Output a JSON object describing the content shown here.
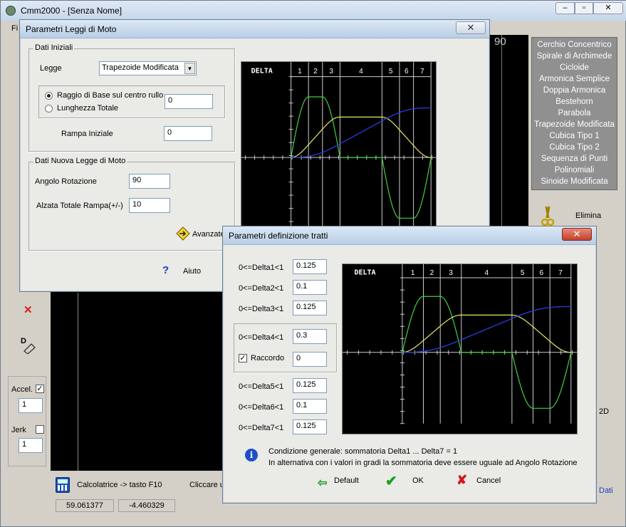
{
  "main": {
    "title": "Cmm2000 - [Senza Nome]",
    "menu_fragment": "Fi",
    "angle_label": "90",
    "elimina": "Elimina",
    "dati": "Dati",
    "side_fragment_2d": "2D",
    "accel_label": "Accel.",
    "accel_value": "1",
    "jerk_label": "Jerk",
    "jerk_value": "1",
    "calc_label": "Calcolatrice -> tasto F10",
    "click_fragment": "Cliccare u",
    "coord_x": "59.061377",
    "coord_y": "-4.460329",
    "laws_list": [
      "Cerchio Concentrico",
      "Spirale di Archimede",
      "Cicloide",
      "Armonica Semplice",
      "Doppia Armonica",
      "Bestehorn",
      "Parabola",
      "Trapezoide Modificata",
      "Cubica Tipo 1",
      "Cubica Tipo 2",
      "Sequenza di Punti",
      "Polinomiali",
      "Sinoide Modificata"
    ]
  },
  "dialog1": {
    "title": "Parametri Leggi di Moto",
    "close": "✕",
    "group_iniziali": "Dati Iniziali",
    "legge_label": "Legge",
    "legge_value": "Trapezoide Modificata",
    "radio1": "Raggio di Base sul centro rullo",
    "radio2": "Lunghezza Totale",
    "raggio_value": "0",
    "rampa_label": "Rampa Iniziale",
    "rampa_value": "0",
    "group_nuova": "Dati Nuova Legge di Moto",
    "angolo_label": "Angolo Rotazione",
    "angolo_value": "90",
    "alzata_label": "Alzata Totale Rampa(+/-)",
    "alzata_value": "10",
    "avanzate": "Avanzate",
    "aiuto": "Aiuto"
  },
  "dialog2": {
    "title": "Parametri definizione tratti",
    "close": "✕",
    "delta1_label": "0<=Delta1<1",
    "delta1_value": "0.125",
    "delta2_label": "0<=Delta2<1",
    "delta2_value": "0.1",
    "delta3_label": "0<=Delta3<1",
    "delta3_value": "0.125",
    "delta4_label": "0<=Delta4<1",
    "delta4_value": "0.3",
    "raccordo_label": "Raccordo",
    "raccordo_value": "0",
    "delta5_label": "0<=Delta5<1",
    "delta5_value": "0.125",
    "delta6_label": "0<=Delta6<1",
    "delta6_value": "0.1",
    "delta7_label": "0<=Delta7<1",
    "delta7_value": "0.125",
    "info_line1": "Condizione generale:  sommatoria Delta1 ... Delta7 = 1",
    "info_line2": "In alternativa con i valori in gradi la sommatoria deve essere uguale ad Angolo Rotazione",
    "default_btn": "Default",
    "ok_btn": "OK",
    "cancel_btn": "Cancel"
  },
  "chart_data": {
    "type": "line",
    "title": "DELTA",
    "segments": [
      "1",
      "2",
      "3",
      "4",
      "5",
      "6",
      "7"
    ],
    "deltas": [
      0.125,
      0.1,
      0.125,
      0.3,
      0.125,
      0.1,
      0.125
    ],
    "series_colors": {
      "acceleration": "#3fd13f",
      "velocity": "#e8e86a",
      "displacement": "#2a3de0"
    }
  }
}
